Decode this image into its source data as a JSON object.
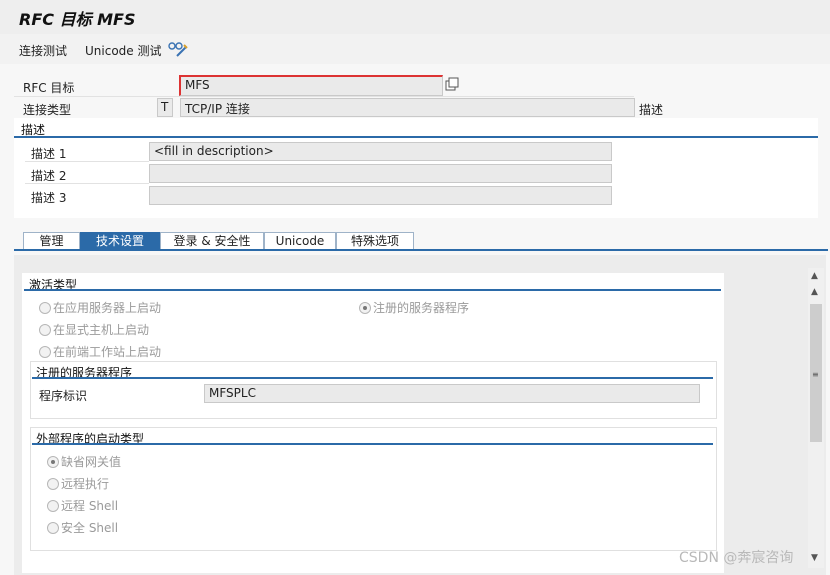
{
  "window": {
    "title": "RFC 目标 MFS"
  },
  "toolbar": {
    "connection_test": "连接测试",
    "unicode_test": "Unicode 测试",
    "tool_icon": "glasses-pencil-icon"
  },
  "header": {
    "rfc_target_label": "RFC 目标",
    "rfc_target_value": "MFS",
    "conn_type_label": "连接类型",
    "conn_type_code": "T",
    "conn_type_value": "TCP/IP 连接",
    "desc_side_label": "描述"
  },
  "description": {
    "title": "描述",
    "rows": [
      {
        "label": "描述 1",
        "value": "<fill in description>"
      },
      {
        "label": "描述 2",
        "value": ""
      },
      {
        "label": "描述 3",
        "value": ""
      }
    ]
  },
  "tabs": [
    {
      "label": "管理",
      "active": false
    },
    {
      "label": "技术设置",
      "active": true
    },
    {
      "label": "登录 & 安全性",
      "active": false
    },
    {
      "label": "Unicode",
      "active": false
    },
    {
      "label": "特殊选项",
      "active": false
    }
  ],
  "activation": {
    "title": "激活类型",
    "options": [
      {
        "label": "在应用服务器上启动",
        "selected": false
      },
      {
        "label": "在显式主机上启动",
        "selected": false
      },
      {
        "label": "在前端工作站上启动",
        "selected": false
      },
      {
        "label": "注册的服务器程序",
        "selected": true
      }
    ]
  },
  "registered_server": {
    "title": "注册的服务器程序",
    "program_id_label": "程序标识",
    "program_id_value": "MFSPLC"
  },
  "ext_start": {
    "title": "外部程序的启动类型",
    "options": [
      {
        "label": "缺省网关值",
        "selected": true
      },
      {
        "label": "远程执行",
        "selected": false
      },
      {
        "label": "远程 Shell",
        "selected": false
      },
      {
        "label": "安全 Shell",
        "selected": false
      }
    ]
  },
  "watermark": "CSDN @奔宸咨询"
}
